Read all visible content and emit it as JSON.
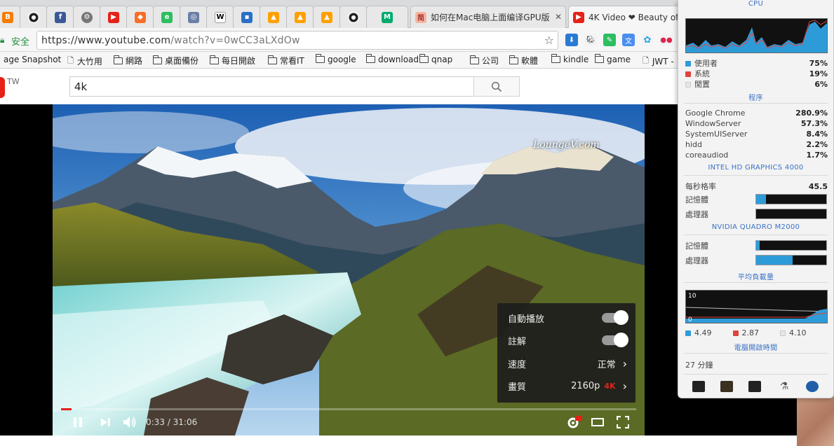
{
  "tabs": {
    "pinned_icons": [
      "blogger-icon",
      "github-icon",
      "facebook-icon",
      "settings-icon",
      "youtube-icon",
      "gitlab-icon",
      "evernote-icon",
      "gamepad-icon",
      "wikipedia-icon",
      "floppy-icon",
      "firebase-icon",
      "firebase-icon",
      "firebase-icon",
      "github-icon",
      "medium-icon"
    ],
    "tab1_title": "如何在Mac电脑上面编译GPU版",
    "tab2_title": "4K Video ❤ Beauty of",
    "close_glyph": "✕"
  },
  "address": {
    "secure_label": "安全",
    "url_scheme": "https://",
    "url_host": "www.youtube.com",
    "url_path": "/watch?v=0wCC3aLXdOw"
  },
  "bookmarks": [
    {
      "label": "age Snapshot",
      "type": "page"
    },
    {
      "label": "大竹用",
      "type": "page"
    },
    {
      "label": "網路",
      "type": "folder"
    },
    {
      "label": "桌面備份",
      "type": "folder"
    },
    {
      "label": "每日開啟",
      "type": "folder"
    },
    {
      "label": "常看IT",
      "type": "folder"
    },
    {
      "label": "google",
      "type": "folder"
    },
    {
      "label": "download",
      "type": "folder"
    },
    {
      "label": "qnap",
      "type": "folder"
    },
    {
      "label": "公司",
      "type": "folder"
    },
    {
      "label": "軟體",
      "type": "folder"
    },
    {
      "label": "kindle",
      "type": "folder"
    },
    {
      "label": "game",
      "type": "folder"
    },
    {
      "label": "JWT -",
      "type": "page"
    }
  ],
  "youtube": {
    "region": "TW",
    "search_value": "4k",
    "watermark": "LoungeV.com",
    "time_current": "0:33",
    "time_sep": " / ",
    "time_total": "31:06",
    "progress": 0.018,
    "menu": {
      "autoplay_label": "自動播放",
      "annotations_label": "註解",
      "speed_label": "速度",
      "speed_value": "正常",
      "quality_label": "畫質",
      "quality_value": "2160p",
      "quality_badge": "4K"
    }
  },
  "istat": {
    "cpu_title": "CPU",
    "cpu_user_label": "使用者",
    "cpu_user_value": "75%",
    "cpu_sys_label": "系統",
    "cpu_sys_value": "19%",
    "cpu_idle_label": "閒置",
    "cpu_idle_value": "6%",
    "process_title": "程序",
    "processes": [
      {
        "name": "Google Chrome",
        "value": "280.9%"
      },
      {
        "name": "WindowServer",
        "value": "57.3%"
      },
      {
        "name": "SystemUIServer",
        "value": "8.4%"
      },
      {
        "name": "hidd",
        "value": "2.2%"
      },
      {
        "name": "coreaudiod",
        "value": "1.7%"
      }
    ],
    "gpu1_title": "INTEL HD GRAPHICS 4000",
    "fps_label": "每秒格率",
    "fps_value": "45.5",
    "gpu1_mem_label": "記憶體",
    "gpu1_mem_level": 0.14,
    "gpu1_proc_label": "處理器",
    "gpu1_proc_level": 0.0,
    "gpu2_title": "NVIDIA QUADRO M2000",
    "gpu2_mem_label": "記憶體",
    "gpu2_mem_level": 0.05,
    "gpu2_proc_label": "處理器",
    "gpu2_proc_level": 0.52,
    "load_title": "平均負載量",
    "load_max": "10",
    "load_min": "0",
    "load1": "4.49",
    "load5": "2.87",
    "load15": "4.10",
    "uptime_title": "電腦開啟時間",
    "uptime_value": "27 分鐘",
    "colors": {
      "user": "#2e9bd9",
      "system": "#e0443a",
      "idle": "#e6e6e6",
      "accent": "#3a71c4"
    }
  }
}
